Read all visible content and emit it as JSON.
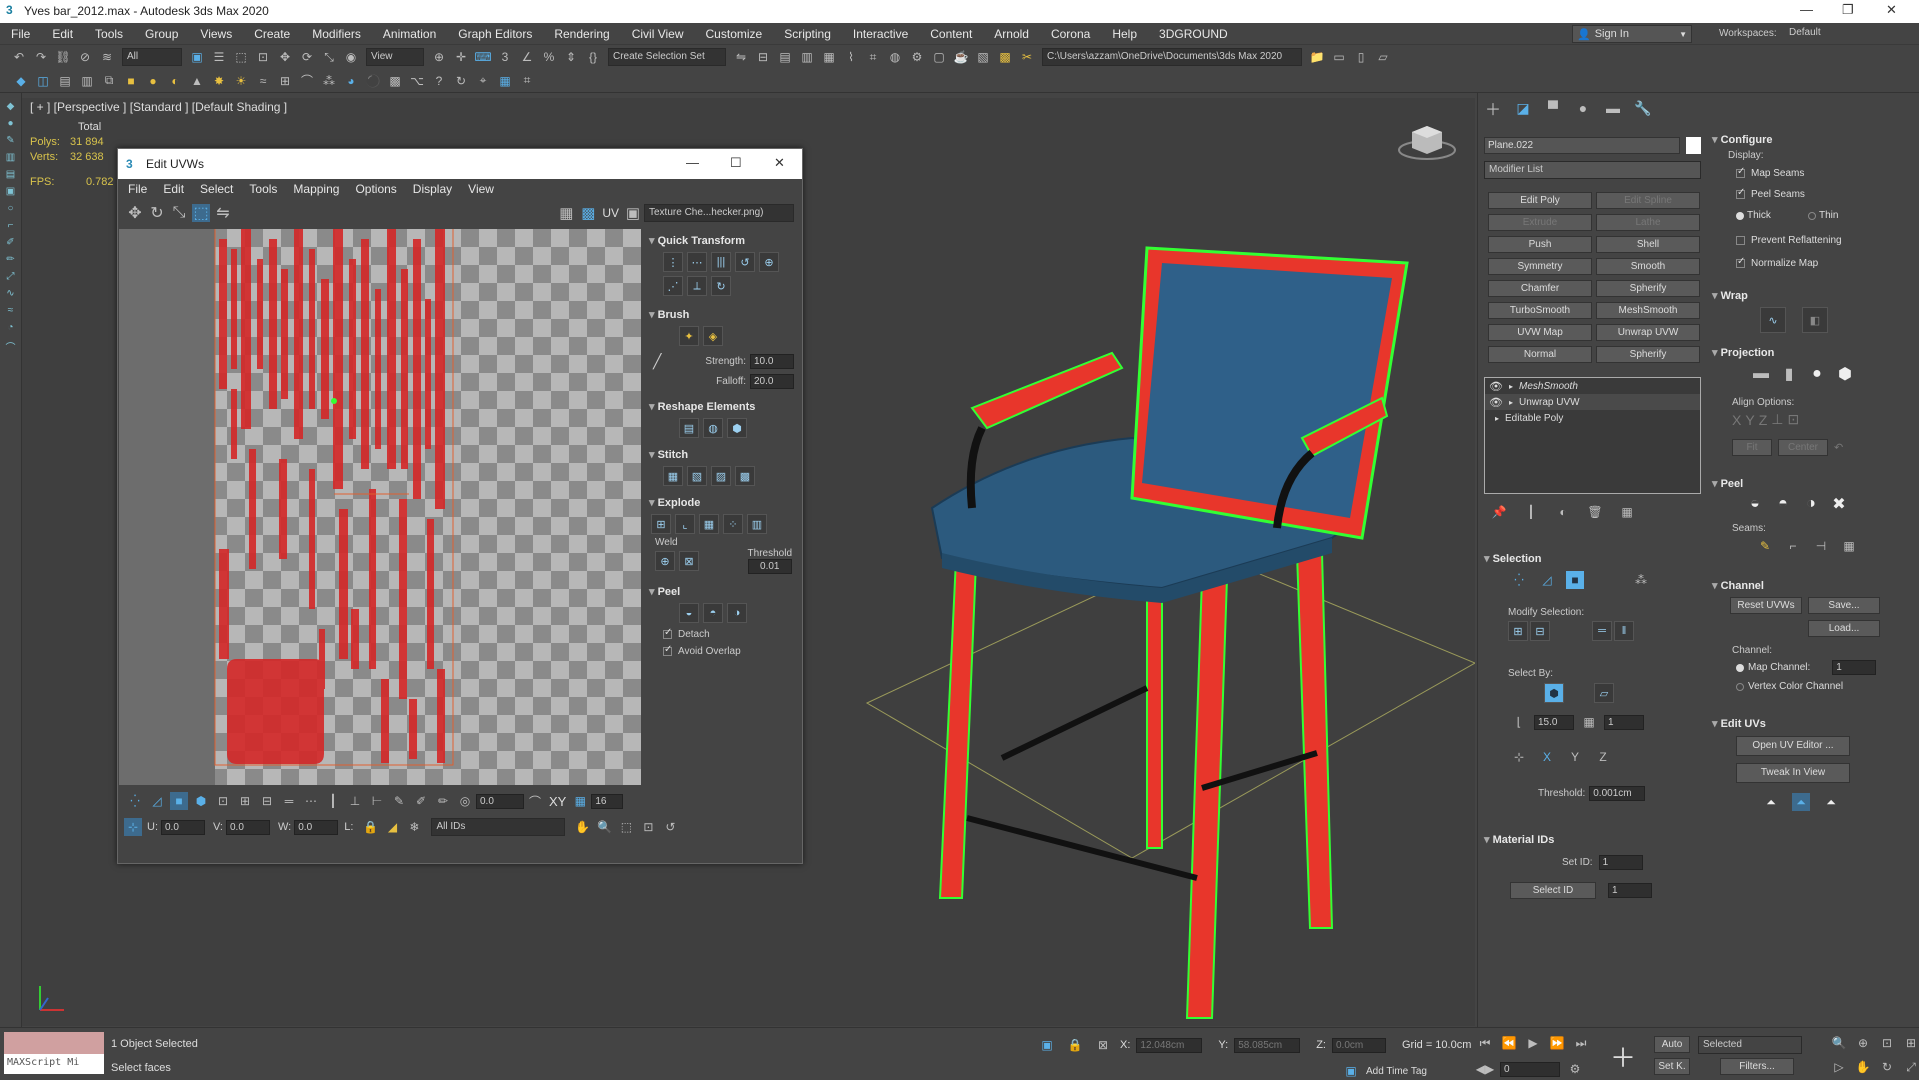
{
  "title": "Yves bar_2012.max - Autodesk 3ds Max 2020",
  "menu": [
    "File",
    "Edit",
    "Tools",
    "Group",
    "Views",
    "Create",
    "Modifiers",
    "Animation",
    "Graph Editors",
    "Rendering",
    "Civil View",
    "Customize",
    "Scripting",
    "Interactive",
    "Content",
    "Arnold",
    "Corona",
    "Help",
    "3DGROUND"
  ],
  "signin": "Sign In",
  "workspaces_label": "Workspaces:",
  "workspaces_value": "Default",
  "toolbar": {
    "filter": "All",
    "view": "View",
    "create_selection_set": "Create Selection Set",
    "project_path": "C:\\Users\\azzam\\OneDrive\\Documents\\3ds Max 2020"
  },
  "viewport": {
    "label": "[ + ] [Perspective ] [Standard ] [Default Shading ]",
    "total_label": "Total",
    "polys_label": "Polys:",
    "polys": "31 894",
    "verts_label": "Verts:",
    "verts": "32 638",
    "fps_label": "FPS:",
    "fps": "0.782"
  },
  "uvw": {
    "title": "Edit UVWs",
    "menu": [
      "File",
      "Edit",
      "Select",
      "Tools",
      "Mapping",
      "Options",
      "Display",
      "View"
    ],
    "uv_label": "UV",
    "texture": "Texture Che...hecker.png)",
    "quick_transform": "Quick Transform",
    "brush": "Brush",
    "strength_label": "Strength:",
    "strength": "10.0",
    "falloff_label": "Falloff:",
    "falloff": "20.0",
    "reshape": "Reshape Elements",
    "stitch": "Stitch",
    "explode": "Explode",
    "weld": "Weld",
    "threshold_label": "Threshold",
    "threshold": "0.01",
    "peel": "Peel",
    "detach": "Detach",
    "avoid_overlap": "Avoid Overlap",
    "bottom_value1": "0.0",
    "bottom_value2": "16",
    "u_label": "U:",
    "u": "0.0",
    "v_label": "V:",
    "v": "0.0",
    "w_label": "W:",
    "w": "0.0",
    "l_label": "L:",
    "all_ids": "All IDs",
    "xy": "XY"
  },
  "cmd": {
    "object_name": "Plane.022",
    "modifier_list": "Modifier List",
    "buttons": [
      [
        "Edit Poly",
        "Edit Spline"
      ],
      [
        "Extrude",
        "Lathe"
      ],
      [
        "Push",
        "Shell"
      ],
      [
        "Symmetry",
        "Smooth"
      ],
      [
        "Chamfer",
        "Spherify"
      ],
      [
        "TurboSmooth",
        "MeshSmooth"
      ],
      [
        "UVW Map",
        "Unwrap UVW"
      ],
      [
        "Normal",
        "Spherify"
      ]
    ],
    "stack": [
      "MeshSmooth",
      "Unwrap UVW",
      "Editable Poly"
    ],
    "selection": "Selection",
    "modify_selection": "Modify Selection:",
    "select_by": "Select By:",
    "angle": "15.0",
    "count": "1",
    "threshold_label": "Threshold:",
    "threshold": "0.001cm",
    "material_ids": "Material IDs",
    "set_id_label": "Set ID:",
    "set_id": "1",
    "select_id": "Select ID",
    "select_id_value": "1"
  },
  "cfg": {
    "configure": "Configure",
    "display": "Display:",
    "map_seams": "Map Seams",
    "peel_seams": "Peel Seams",
    "thick": "Thick",
    "thin": "Thin",
    "prevent": "Prevent Reflattening",
    "normalize": "Normalize Map",
    "wrap": "Wrap",
    "projection": "Projection",
    "align": "Align Options:",
    "fit": "Fit",
    "center": "Center",
    "peel": "Peel",
    "seams": "Seams:",
    "channel": "Channel",
    "reset_uvws": "Reset UVWs",
    "save": "Save...",
    "load": "Load...",
    "channel_label": "Channel:",
    "map_channel": "Map Channel:",
    "map_channel_value": "1",
    "vertex_color": "Vertex Color Channel",
    "edit_uvs": "Edit UVs",
    "open_uv": "Open UV Editor ...",
    "tweak": "Tweak In View"
  },
  "status": {
    "maxscript": "MAXScript Mi",
    "objects": "1 Object Selected",
    "prompt": "Select faces",
    "x_label": "X:",
    "x": "12.048cm",
    "y_label": "Y:",
    "y": "58.085cm",
    "z_label": "Z:",
    "z": "0.0cm",
    "grid": "Grid = 10.0cm",
    "auto": "Auto",
    "selected": "Selected",
    "setk": "Set K.",
    "filters": "Filters...",
    "add_time_tag": "Add Time Tag",
    "frame": "0"
  }
}
